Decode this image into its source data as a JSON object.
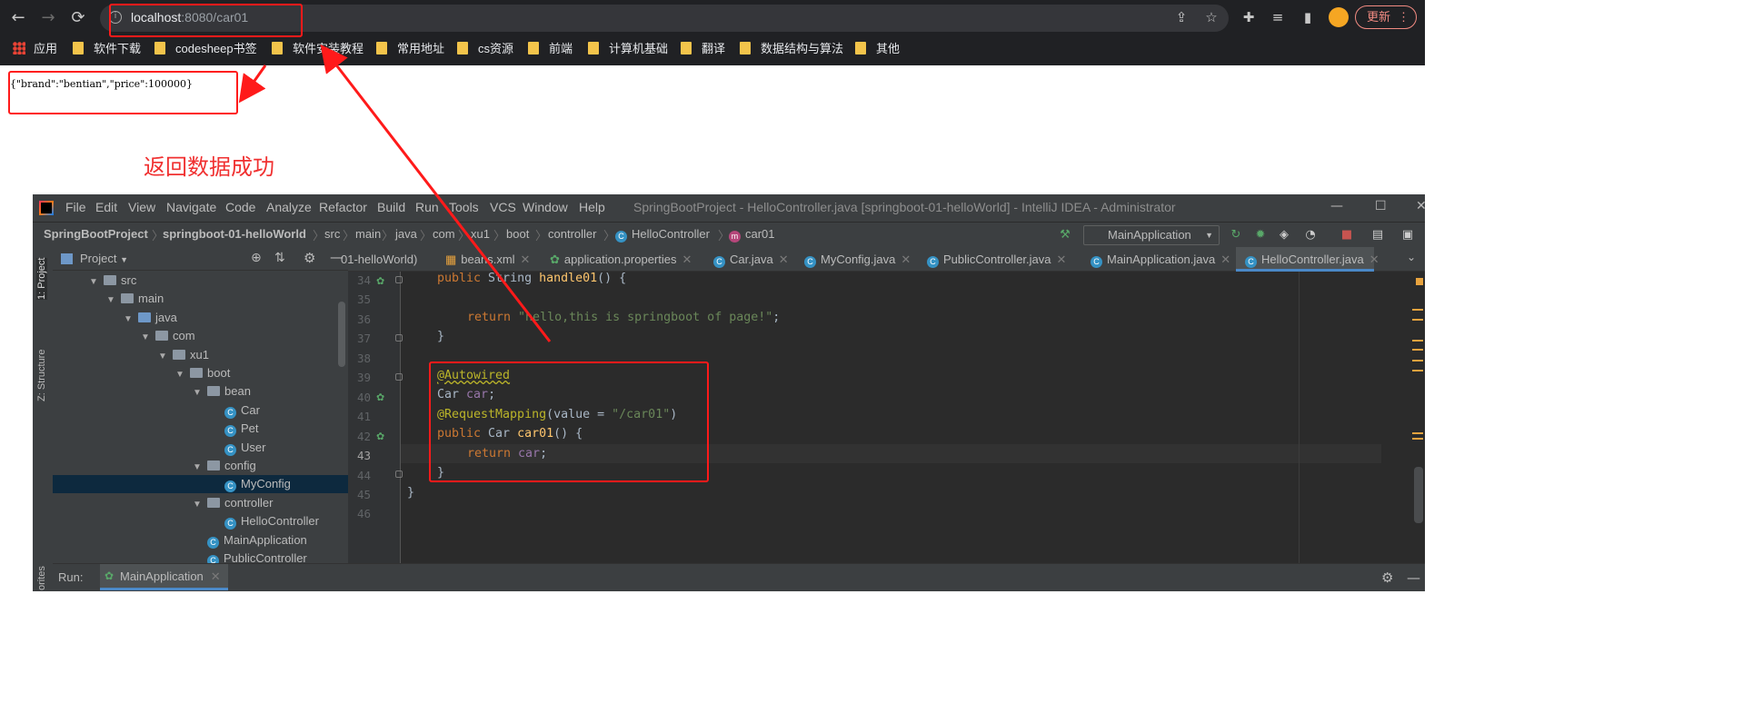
{
  "browser": {
    "url_host": "localhost",
    "url_path": ":8080/car01",
    "update_label": "更新",
    "bookmarks": [
      {
        "label": "应用",
        "type": "apps"
      },
      {
        "label": "软件下载"
      },
      {
        "label": "codesheep书签"
      },
      {
        "label": "软件安装教程"
      },
      {
        "label": "常用地址"
      },
      {
        "label": "cs资源"
      },
      {
        "label": "前端"
      },
      {
        "label": "计算机基础"
      },
      {
        "label": "翻译"
      },
      {
        "label": "数据结构与算法"
      },
      {
        "label": "其他"
      }
    ]
  },
  "response_json": "{\"brand\":\"bentian\",\"price\":100000}",
  "annotation": {
    "caption": "返回数据成功",
    "color": "#ff1a1a"
  },
  "ide": {
    "menu": [
      "File",
      "Edit",
      "View",
      "Navigate",
      "Code",
      "Analyze",
      "Refactor",
      "Build",
      "Run",
      "Tools",
      "VCS",
      "Window",
      "Help"
    ],
    "window_title": "SpringBootProject - HelloController.java [springboot-01-helloWorld] - IntelliJ IDEA - Administrator",
    "breadcrumbs": [
      "SpringBootProject",
      "springboot-01-helloWorld",
      "src",
      "main",
      "java",
      "com",
      "xu1",
      "boot",
      "controller",
      "HelloController",
      "car01"
    ],
    "run_config": "MainApplication",
    "project_label": "Project",
    "side_tabs": {
      "project": "1: Project",
      "structure": "Z: Structure",
      "favorites": "orites"
    },
    "tree": [
      {
        "label": "src",
        "depth": 0,
        "type": "folder"
      },
      {
        "label": "main",
        "depth": 1,
        "type": "folder"
      },
      {
        "label": "java",
        "depth": 2,
        "type": "folder-blue"
      },
      {
        "label": "com",
        "depth": 3,
        "type": "package"
      },
      {
        "label": "xu1",
        "depth": 4,
        "type": "package"
      },
      {
        "label": "boot",
        "depth": 5,
        "type": "package"
      },
      {
        "label": "bean",
        "depth": 6,
        "type": "package"
      },
      {
        "label": "Car",
        "depth": 7,
        "type": "class"
      },
      {
        "label": "Pet",
        "depth": 7,
        "type": "class"
      },
      {
        "label": "User",
        "depth": 7,
        "type": "class"
      },
      {
        "label": "config",
        "depth": 6,
        "type": "package"
      },
      {
        "label": "MyConfig",
        "depth": 7,
        "type": "class",
        "selected": true
      },
      {
        "label": "controller",
        "depth": 6,
        "type": "package"
      },
      {
        "label": "HelloController",
        "depth": 7,
        "type": "class"
      },
      {
        "label": "MainApplication",
        "depth": 6,
        "type": "spring-class"
      },
      {
        "label": "PublicController",
        "depth": 6,
        "type": "class"
      }
    ],
    "tabs": [
      {
        "label": "01-helloWorld)",
        "icon": "none"
      },
      {
        "label": "beans.xml",
        "icon": "xml"
      },
      {
        "label": "application.properties",
        "icon": "spring"
      },
      {
        "label": "Car.java",
        "icon": "class"
      },
      {
        "label": "MyConfig.java",
        "icon": "class"
      },
      {
        "label": "PublicController.java",
        "icon": "class"
      },
      {
        "label": "MainApplication.java",
        "icon": "spring-class"
      },
      {
        "label": "HelloController.java",
        "icon": "class",
        "active": true
      }
    ],
    "line_numbers": [
      "34",
      "35",
      "36",
      "37",
      "38",
      "39",
      "40",
      "41",
      "42",
      "43",
      "44",
      "45",
      "46"
    ],
    "run_label": "Run:",
    "run_tab": "MainApplication"
  }
}
